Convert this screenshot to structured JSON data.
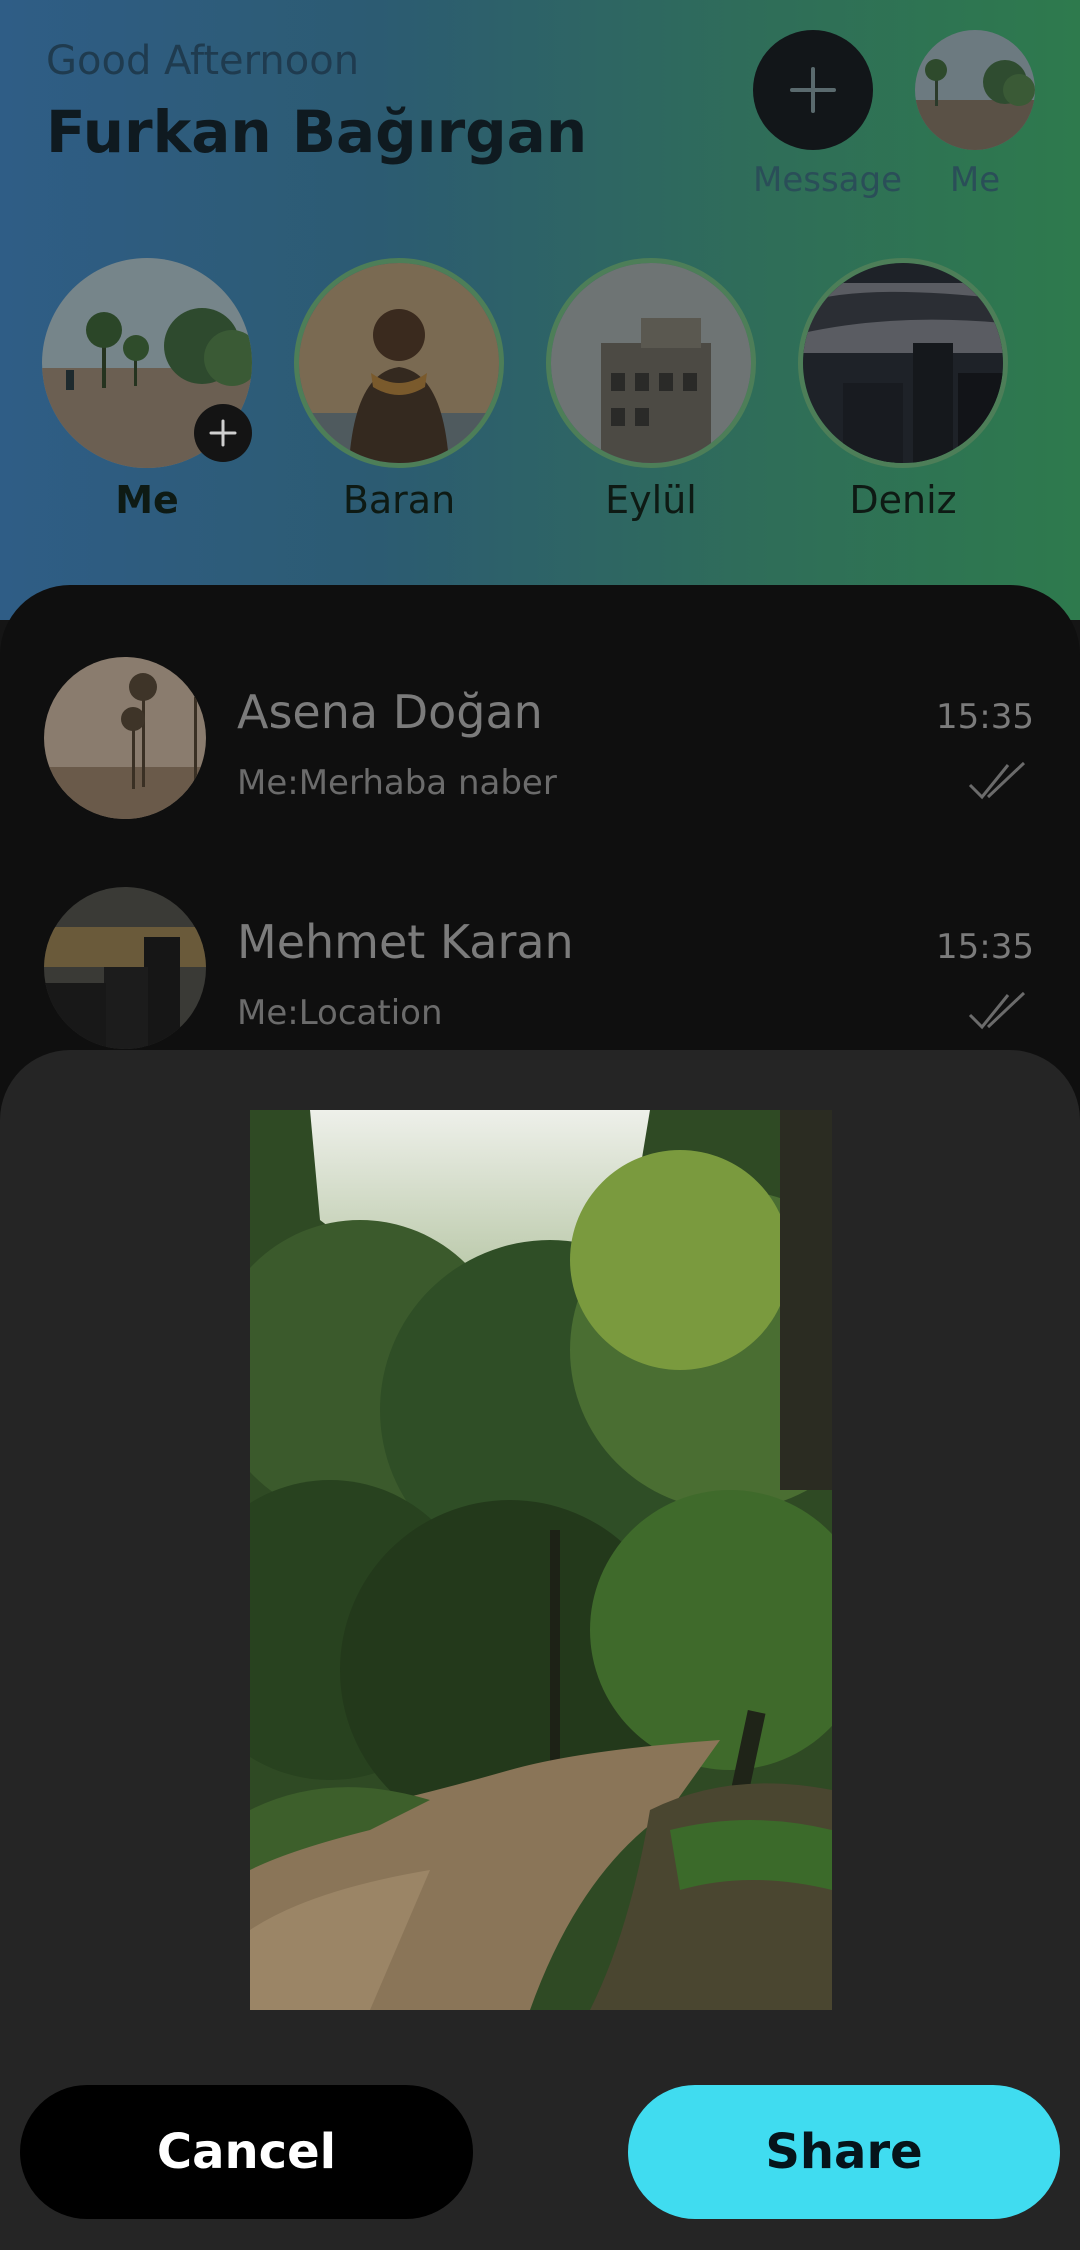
{
  "header": {
    "greeting": "Good Afternoon",
    "user_name": "Furkan Bağırgan",
    "actions": [
      {
        "label": "Message",
        "icon": "plus-icon"
      },
      {
        "label": "Me",
        "icon": "profile-photo"
      }
    ]
  },
  "stories": [
    {
      "name": "Me",
      "has_add_badge": true
    },
    {
      "name": "Baran"
    },
    {
      "name": "Eylül"
    },
    {
      "name": "Deniz"
    }
  ],
  "chats": [
    {
      "name": "Asena Doğan",
      "last_message": "Me:Merhaba naber",
      "time": "15:35",
      "status_icon": "double-check-icon"
    },
    {
      "name": "Mehmet Karan",
      "last_message": "Me:Location",
      "time": "15:35",
      "status_icon": "double-check-icon"
    }
  ],
  "share_sheet": {
    "cancel_label": "Cancel",
    "share_label": "Share"
  },
  "colors": {
    "accent": "#40dcf0",
    "sheet_bg": "#252525",
    "list_bg": "#0f0f0f"
  }
}
